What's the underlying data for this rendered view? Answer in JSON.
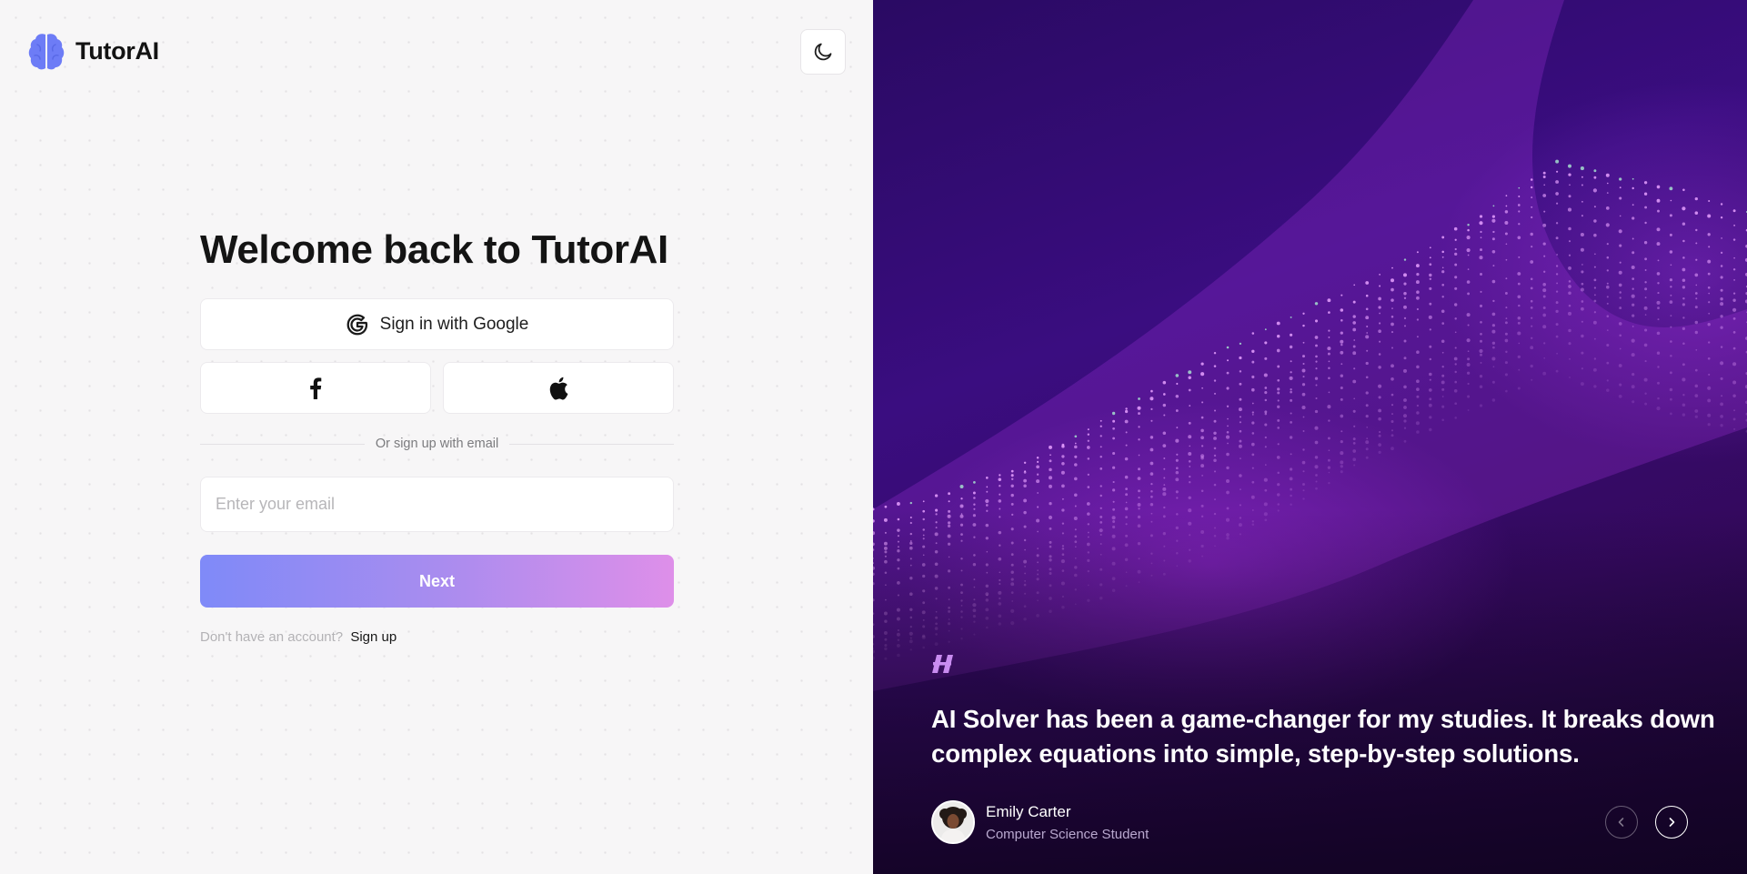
{
  "brand": {
    "name": "TutorAI",
    "logo_icon": "brain-icon",
    "logo_color": "#6d7cf6"
  },
  "theme_toggle": {
    "icon": "moon-icon"
  },
  "login": {
    "title": "Welcome back to TutorAI",
    "google_label": "Sign in with Google",
    "google_icon": "google-icon",
    "facebook_icon": "facebook-icon",
    "apple_icon": "apple-icon",
    "divider_text": "Or sign up with email",
    "email_placeholder": "Enter your email",
    "email_value": "",
    "next_label": "Next",
    "no_account_text": "Don't have an account?",
    "signup_link": "Sign up"
  },
  "testimonial": {
    "quote_icon": "quote-icon",
    "quote": "AI Solver has been a game-changer for my studies. It breaks down complex equations into simple, step-by-step solutions.",
    "author_name": "Emily Carter",
    "author_role": "Computer Science Student",
    "prev_icon": "chevron-left-icon",
    "next_icon": "chevron-right-icon"
  },
  "colors": {
    "accent_gradient_start": "#7f8af8",
    "accent_gradient_end": "#de8fe9",
    "panel_purple": "#3a0d80",
    "quote_mark": "#c98cf0"
  }
}
